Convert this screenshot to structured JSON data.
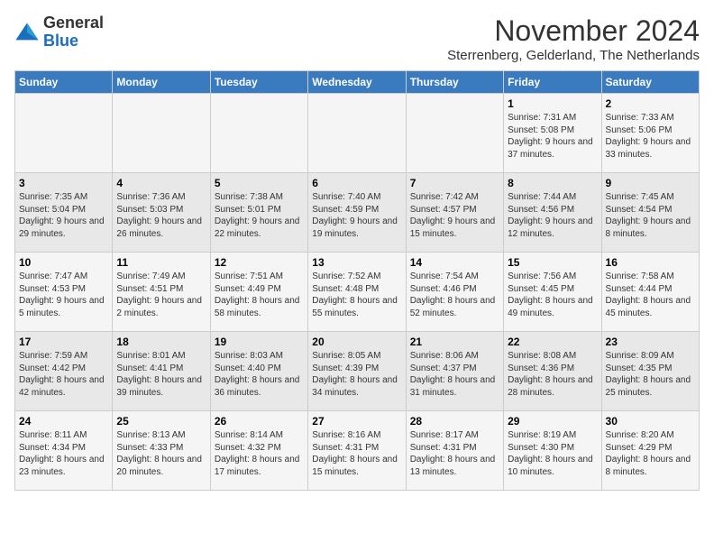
{
  "logo": {
    "general": "General",
    "blue": "Blue"
  },
  "header": {
    "month_year": "November 2024",
    "location": "Sterrenberg, Gelderland, The Netherlands"
  },
  "days_of_week": [
    "Sunday",
    "Monday",
    "Tuesday",
    "Wednesday",
    "Thursday",
    "Friday",
    "Saturday"
  ],
  "weeks": [
    [
      {
        "day": "",
        "info": ""
      },
      {
        "day": "",
        "info": ""
      },
      {
        "day": "",
        "info": ""
      },
      {
        "day": "",
        "info": ""
      },
      {
        "day": "",
        "info": ""
      },
      {
        "day": "1",
        "info": "Sunrise: 7:31 AM\nSunset: 5:08 PM\nDaylight: 9 hours and 37 minutes."
      },
      {
        "day": "2",
        "info": "Sunrise: 7:33 AM\nSunset: 5:06 PM\nDaylight: 9 hours and 33 minutes."
      }
    ],
    [
      {
        "day": "3",
        "info": "Sunrise: 7:35 AM\nSunset: 5:04 PM\nDaylight: 9 hours and 29 minutes."
      },
      {
        "day": "4",
        "info": "Sunrise: 7:36 AM\nSunset: 5:03 PM\nDaylight: 9 hours and 26 minutes."
      },
      {
        "day": "5",
        "info": "Sunrise: 7:38 AM\nSunset: 5:01 PM\nDaylight: 9 hours and 22 minutes."
      },
      {
        "day": "6",
        "info": "Sunrise: 7:40 AM\nSunset: 4:59 PM\nDaylight: 9 hours and 19 minutes."
      },
      {
        "day": "7",
        "info": "Sunrise: 7:42 AM\nSunset: 4:57 PM\nDaylight: 9 hours and 15 minutes."
      },
      {
        "day": "8",
        "info": "Sunrise: 7:44 AM\nSunset: 4:56 PM\nDaylight: 9 hours and 12 minutes."
      },
      {
        "day": "9",
        "info": "Sunrise: 7:45 AM\nSunset: 4:54 PM\nDaylight: 9 hours and 8 minutes."
      }
    ],
    [
      {
        "day": "10",
        "info": "Sunrise: 7:47 AM\nSunset: 4:53 PM\nDaylight: 9 hours and 5 minutes."
      },
      {
        "day": "11",
        "info": "Sunrise: 7:49 AM\nSunset: 4:51 PM\nDaylight: 9 hours and 2 minutes."
      },
      {
        "day": "12",
        "info": "Sunrise: 7:51 AM\nSunset: 4:49 PM\nDaylight: 8 hours and 58 minutes."
      },
      {
        "day": "13",
        "info": "Sunrise: 7:52 AM\nSunset: 4:48 PM\nDaylight: 8 hours and 55 minutes."
      },
      {
        "day": "14",
        "info": "Sunrise: 7:54 AM\nSunset: 4:46 PM\nDaylight: 8 hours and 52 minutes."
      },
      {
        "day": "15",
        "info": "Sunrise: 7:56 AM\nSunset: 4:45 PM\nDaylight: 8 hours and 49 minutes."
      },
      {
        "day": "16",
        "info": "Sunrise: 7:58 AM\nSunset: 4:44 PM\nDaylight: 8 hours and 45 minutes."
      }
    ],
    [
      {
        "day": "17",
        "info": "Sunrise: 7:59 AM\nSunset: 4:42 PM\nDaylight: 8 hours and 42 minutes."
      },
      {
        "day": "18",
        "info": "Sunrise: 8:01 AM\nSunset: 4:41 PM\nDaylight: 8 hours and 39 minutes."
      },
      {
        "day": "19",
        "info": "Sunrise: 8:03 AM\nSunset: 4:40 PM\nDaylight: 8 hours and 36 minutes."
      },
      {
        "day": "20",
        "info": "Sunrise: 8:05 AM\nSunset: 4:39 PM\nDaylight: 8 hours and 34 minutes."
      },
      {
        "day": "21",
        "info": "Sunrise: 8:06 AM\nSunset: 4:37 PM\nDaylight: 8 hours and 31 minutes."
      },
      {
        "day": "22",
        "info": "Sunrise: 8:08 AM\nSunset: 4:36 PM\nDaylight: 8 hours and 28 minutes."
      },
      {
        "day": "23",
        "info": "Sunrise: 8:09 AM\nSunset: 4:35 PM\nDaylight: 8 hours and 25 minutes."
      }
    ],
    [
      {
        "day": "24",
        "info": "Sunrise: 8:11 AM\nSunset: 4:34 PM\nDaylight: 8 hours and 23 minutes."
      },
      {
        "day": "25",
        "info": "Sunrise: 8:13 AM\nSunset: 4:33 PM\nDaylight: 8 hours and 20 minutes."
      },
      {
        "day": "26",
        "info": "Sunrise: 8:14 AM\nSunset: 4:32 PM\nDaylight: 8 hours and 17 minutes."
      },
      {
        "day": "27",
        "info": "Sunrise: 8:16 AM\nSunset: 4:31 PM\nDaylight: 8 hours and 15 minutes."
      },
      {
        "day": "28",
        "info": "Sunrise: 8:17 AM\nSunset: 4:31 PM\nDaylight: 8 hours and 13 minutes."
      },
      {
        "day": "29",
        "info": "Sunrise: 8:19 AM\nSunset: 4:30 PM\nDaylight: 8 hours and 10 minutes."
      },
      {
        "day": "30",
        "info": "Sunrise: 8:20 AM\nSunset: 4:29 PM\nDaylight: 8 hours and 8 minutes."
      }
    ]
  ]
}
